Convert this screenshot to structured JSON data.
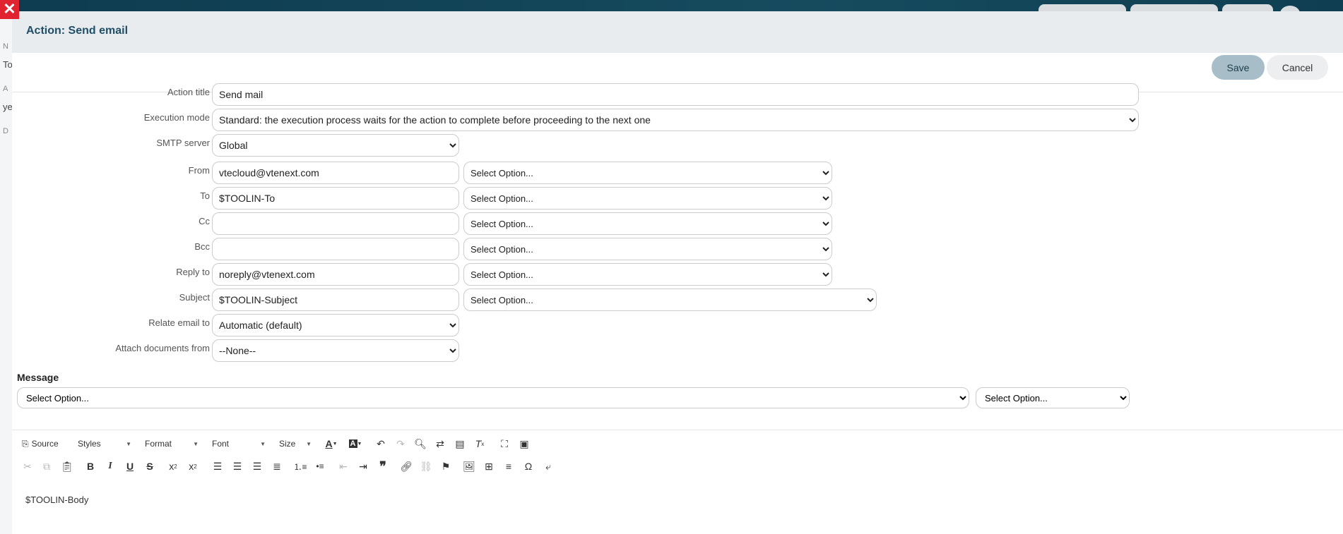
{
  "modal": {
    "title": "Action: Send email",
    "save_label": "Save",
    "cancel_label": "Cancel"
  },
  "bg_left_letters": [
    "N",
    "To",
    "A",
    "ye",
    "D"
  ],
  "fields": {
    "action_title": {
      "label": "Action title",
      "value": "Send mail"
    },
    "execution_mode": {
      "label": "Execution mode",
      "value": "Standard: the execution process waits for the action to complete before proceeding to the next one"
    },
    "smtp_server": {
      "label": "SMTP server",
      "value": "Global"
    },
    "from": {
      "label": "From",
      "value": "vtecloud@vtenext.com",
      "option": "Select Option..."
    },
    "to": {
      "label": "To",
      "value": "$TOOLIN-To",
      "option": "Select Option..."
    },
    "cc": {
      "label": "Cc",
      "value": "",
      "option": "Select Option..."
    },
    "bcc": {
      "label": "Bcc",
      "value": "",
      "option": "Select Option..."
    },
    "reply_to": {
      "label": "Reply to",
      "value": "noreply@vtenext.com",
      "option": "Select Option..."
    },
    "subject": {
      "label": "Subject",
      "value": "$TOOLIN-Subject",
      "option": "Select Option..."
    },
    "relate_email": {
      "label": "Relate email to",
      "value": "Automatic (default)"
    },
    "attach_documents": {
      "label": "Attach documents from",
      "value": "--None--"
    }
  },
  "message": {
    "title": "Message",
    "option_left": "Select Option...",
    "option_right": "Select Option...",
    "body": "$TOOLIN-Body"
  },
  "editor_toolbar": {
    "source_label": "Source",
    "styles_label": "Styles",
    "format_label": "Format",
    "font_label": "Font",
    "size_label": "Size"
  },
  "colors": {
    "accent": "#1f4e66",
    "save_bg": "#a7bdc8",
    "close_red": "#e0232e"
  }
}
